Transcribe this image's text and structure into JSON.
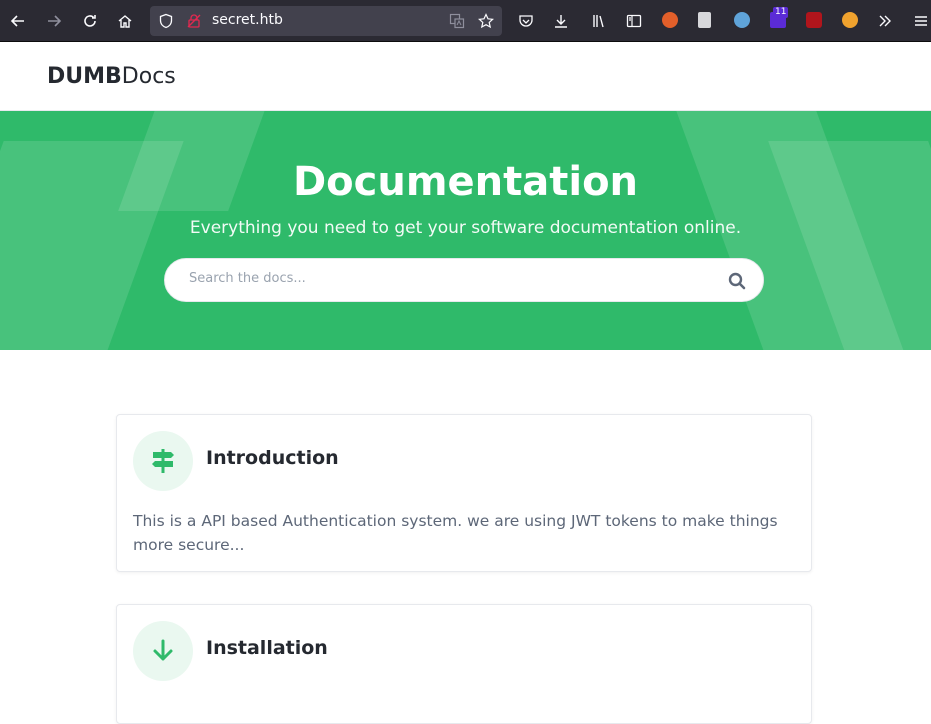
{
  "browser": {
    "url": "secret.htb",
    "badge_count": "11",
    "icons": [
      "back-icon",
      "forward-icon",
      "reload-icon",
      "home-icon",
      "shield-icon",
      "lock-icon",
      "translate-icon",
      "star-icon",
      "pocket-icon",
      "download-icon",
      "library-icon",
      "sidebar-icon",
      "ext-foxyproxy-icon",
      "ext-page-icon",
      "ext-wappalyzer-icon",
      "ext-hacktools-icon",
      "ext-ublock-icon",
      "ext-cookie-editor-icon",
      "overflow-icon",
      "menu-icon"
    ],
    "colors": {
      "toolbar": "#2b2a33",
      "urlbar": "#42414d"
    }
  },
  "site": {
    "logo_bold": "DUMB",
    "logo_light": "Docs"
  },
  "hero": {
    "title": "Documentation",
    "subtitle": "Everything you need to get your software documentation online.",
    "search_placeholder": "Search the docs...",
    "color": "#2fba6a"
  },
  "cards": [
    {
      "title": "Introduction",
      "text": "This is a API based Authentication system. we are using JWT tokens to make things more secure...",
      "icon": "signpost-icon"
    },
    {
      "title": "Installation",
      "text": "",
      "icon": "arrow-down-icon"
    }
  ]
}
